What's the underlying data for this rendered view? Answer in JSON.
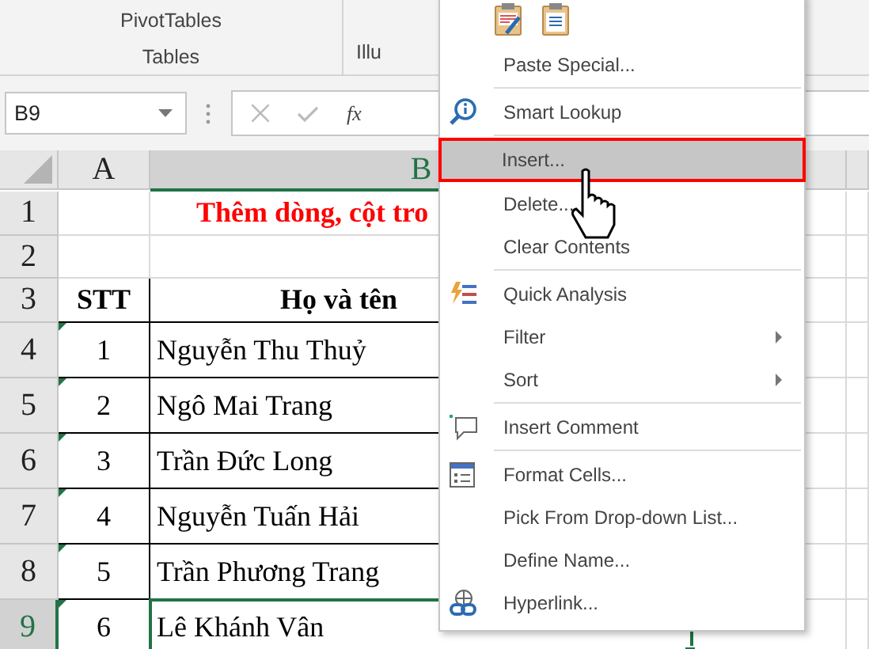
{
  "ribbon": {
    "button": "PivotTables",
    "group": "Tables",
    "next_group": "Illu"
  },
  "formula_bar": {
    "name_box": "B9",
    "function_label": "fx"
  },
  "columns": [
    {
      "label": "A",
      "selected": false
    },
    {
      "label": "B",
      "selected": true
    }
  ],
  "title": "Thêm dòng, cột tro",
  "rows": [
    {
      "number": "1",
      "selected": false
    },
    {
      "number": "2",
      "selected": false
    },
    {
      "number": "3",
      "selected": false,
      "cells": [
        "STT",
        "Họ và tên"
      ]
    },
    {
      "number": "4",
      "selected": false,
      "cells": [
        "1",
        "Nguyễn Thu Thuỷ"
      ]
    },
    {
      "number": "5",
      "selected": false,
      "cells": [
        "2",
        "Ngô Mai Trang"
      ]
    },
    {
      "number": "6",
      "selected": false,
      "cells": [
        "3",
        "Trần Đức Long"
      ]
    },
    {
      "number": "7",
      "selected": false,
      "cells": [
        "4",
        "Nguyễn Tuấn Hải"
      ]
    },
    {
      "number": "8",
      "selected": false,
      "cells": [
        "5",
        "Trần Phương Trang"
      ]
    },
    {
      "number": "9",
      "selected": true,
      "cells": [
        "6",
        "Lê Khánh Vân"
      ]
    }
  ],
  "context_menu": [
    {
      "kind": "paste-icons"
    },
    {
      "kind": "item",
      "label": "Paste Special...",
      "selected": false,
      "submenu": false
    },
    {
      "kind": "separator"
    },
    {
      "kind": "item",
      "label": "Smart Lookup",
      "selected": false,
      "submenu": false
    },
    {
      "kind": "separator"
    },
    {
      "kind": "item",
      "label": "Insert...",
      "selected": true,
      "submenu": false
    },
    {
      "kind": "item",
      "label": "Delete...",
      "selected": false,
      "submenu": false
    },
    {
      "kind": "item",
      "label": "Clear Contents",
      "selected": false,
      "submenu": false
    },
    {
      "kind": "separator"
    },
    {
      "kind": "item",
      "label": "Quick Analysis",
      "selected": false,
      "submenu": false
    },
    {
      "kind": "item",
      "label": "Filter",
      "selected": false,
      "submenu": true
    },
    {
      "kind": "item",
      "label": "Sort",
      "selected": false,
      "submenu": true
    },
    {
      "kind": "separator"
    },
    {
      "kind": "item",
      "label": "Insert Comment",
      "selected": false,
      "submenu": false
    },
    {
      "kind": "separator"
    },
    {
      "kind": "item",
      "label": "Format Cells...",
      "selected": false,
      "submenu": false
    },
    {
      "kind": "item",
      "label": "Pick From Drop-down List...",
      "selected": false,
      "submenu": false
    },
    {
      "kind": "item",
      "label": "Define Name...",
      "selected": false,
      "submenu": false
    },
    {
      "kind": "item",
      "label": "Hyperlink...",
      "selected": false,
      "submenu": false
    }
  ]
}
